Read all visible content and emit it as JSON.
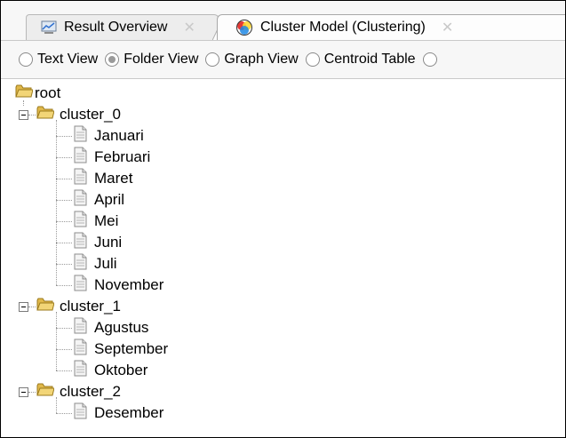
{
  "tabs": [
    {
      "label": "Result Overview",
      "icon": "result-overview-icon",
      "active": false
    },
    {
      "label": "Cluster Model (Clustering)",
      "icon": "cluster-model-icon",
      "active": true
    }
  ],
  "view_options": {
    "items": [
      {
        "label": "Text View",
        "checked": false
      },
      {
        "label": "Folder View",
        "checked": true
      },
      {
        "label": "Graph View",
        "checked": false
      },
      {
        "label": "Centroid Table",
        "checked": false
      }
    ]
  },
  "tree": {
    "root": "root",
    "clusters": [
      {
        "label": "cluster_0",
        "items": [
          "Januari",
          "Februari",
          "Maret",
          "April",
          "Mei",
          "Juni",
          "Juli",
          "November"
        ]
      },
      {
        "label": "cluster_1",
        "items": [
          "Agustus",
          "September",
          "Oktober"
        ]
      },
      {
        "label": "cluster_2",
        "items": [
          "Desember"
        ]
      }
    ]
  }
}
